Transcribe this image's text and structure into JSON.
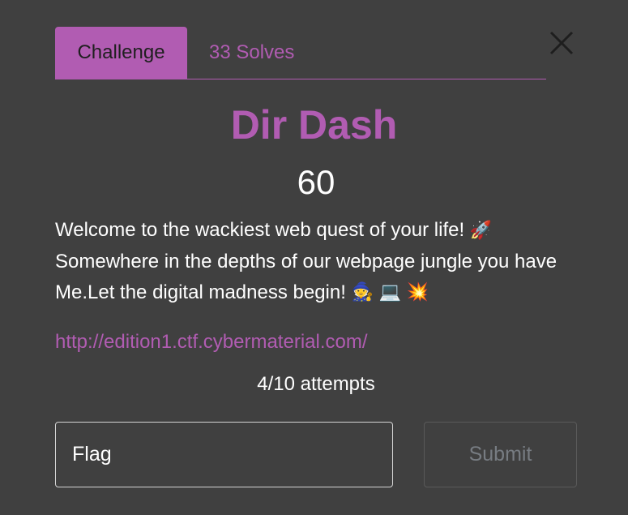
{
  "tabs": {
    "challenge": "Challenge",
    "solves": "33 Solves"
  },
  "challenge": {
    "name": "Dir Dash",
    "value": "60",
    "description_line1": "Welcome to the wackiest web quest of your life! ",
    "description_line2": "Somewhere in the depths of our webpage jungle you have",
    "description_line3": "Me.Let the digital madness begin! ",
    "emojis": {
      "rocket": "🚀",
      "mage": "🧙",
      "laptop": "💻",
      "collision": "💥"
    },
    "link": "http://edition1.ctf.cybermaterial.com/",
    "attempts": "4/10 attempts"
  },
  "form": {
    "flag_placeholder": "Flag",
    "submit_label": "Submit"
  },
  "colors": {
    "accent": "#b15cb2",
    "background": "#404040",
    "text": "#ffffff",
    "submit_text": "#777c82"
  },
  "icons": {
    "close": "close-icon"
  }
}
